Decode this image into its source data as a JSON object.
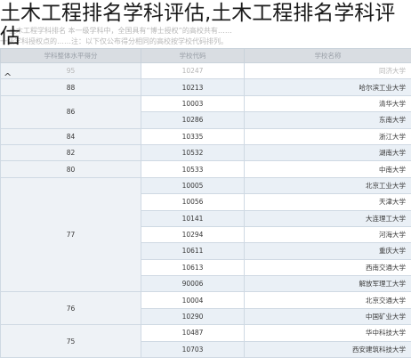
{
  "title": "土木工程排名学科评估,土木工程排名学科评估",
  "notes": [
    "土木工程学科排名 本一级学科中，全国具有“博士授权”的高校共有……",
    "一级学科授权点的……注：以下仅公布得分相同的高校按学校代码排列。"
  ],
  "toggle_glyph": "^",
  "table": {
    "headers": [
      "学科整体水平得分",
      "学校代码",
      "学校名称"
    ],
    "rows": [
      {
        "score": "95",
        "code": "10247",
        "name": "同济大学",
        "dim": true
      },
      {
        "score": "88",
        "code": "10213",
        "name": "哈尔滨工业大学"
      },
      {
        "score": "86",
        "code": "10003",
        "name": "清华大学"
      },
      {
        "code": "10286",
        "name": "东南大学"
      },
      {
        "score": "84",
        "code": "10335",
        "name": "浙江大学"
      },
      {
        "score": "82",
        "code": "10532",
        "name": "湖南大学"
      },
      {
        "score": "80",
        "code": "10533",
        "name": "中南大学"
      },
      {
        "score": "77",
        "code": "10005",
        "name": "北京工业大学"
      },
      {
        "code": "10056",
        "name": "天津大学"
      },
      {
        "code": "10141",
        "name": "大连理工大学"
      },
      {
        "code": "10294",
        "name": "河海大学"
      },
      {
        "code": "10611",
        "name": "重庆大学"
      },
      {
        "code": "10613",
        "name": "西南交通大学"
      },
      {
        "code": "90006",
        "name": "解放军理工大学"
      },
      {
        "score": "76",
        "code": "10004",
        "name": "北京交通大学"
      },
      {
        "code": "10290",
        "name": "中国矿业大学"
      },
      {
        "score": "75",
        "code": "10487",
        "name": "华中科技大学"
      },
      {
        "code": "10703",
        "name": "西安建筑科技大学"
      }
    ]
  }
}
